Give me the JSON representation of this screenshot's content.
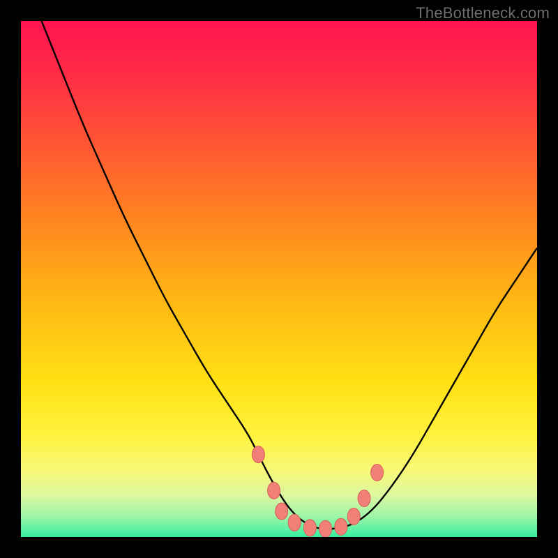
{
  "watermark": "TheBottleneck.com",
  "colors": {
    "gradient_stops": [
      {
        "offset": 0.0,
        "color": "#ff1450"
      },
      {
        "offset": 0.1,
        "color": "#ff2a46"
      },
      {
        "offset": 0.25,
        "color": "#ff5a32"
      },
      {
        "offset": 0.4,
        "color": "#ff8a1e"
      },
      {
        "offset": 0.55,
        "color": "#ffba14"
      },
      {
        "offset": 0.7,
        "color": "#ffe014"
      },
      {
        "offset": 0.8,
        "color": "#fff23c"
      },
      {
        "offset": 0.87,
        "color": "#f8f878"
      },
      {
        "offset": 0.92,
        "color": "#dcf8a0"
      },
      {
        "offset": 0.96,
        "color": "#9ef5a8"
      },
      {
        "offset": 1.0,
        "color": "#34f0a0"
      }
    ],
    "curve": "#000000",
    "marker_fill": "#f08078",
    "marker_stroke": "#d86058"
  },
  "chart_data": {
    "type": "line",
    "title": "",
    "xlabel": "",
    "ylabel": "",
    "xlim": [
      0,
      100
    ],
    "ylim": [
      0,
      100
    ],
    "grid": false,
    "curve": {
      "name": "bottleneck-curve",
      "x": [
        4,
        8,
        12,
        16,
        20,
        24,
        28,
        32,
        36,
        40,
        44,
        46,
        48,
        50,
        52,
        54,
        56,
        58,
        60,
        64,
        68,
        72,
        76,
        80,
        84,
        88,
        92,
        96,
        100
      ],
      "y": [
        100,
        90,
        80,
        71,
        62,
        54,
        46,
        39,
        32,
        26,
        20,
        16,
        12,
        8.5,
        5.5,
        3.5,
        2.2,
        1.6,
        1.5,
        2.2,
        5,
        10,
        16,
        23,
        30,
        37,
        44,
        50,
        56
      ]
    },
    "markers": [
      {
        "x": 46,
        "y": 16
      },
      {
        "x": 49,
        "y": 9
      },
      {
        "x": 50.5,
        "y": 5
      },
      {
        "x": 53,
        "y": 2.8
      },
      {
        "x": 56,
        "y": 1.8
      },
      {
        "x": 59,
        "y": 1.6
      },
      {
        "x": 62,
        "y": 2.0
      },
      {
        "x": 64.5,
        "y": 4.0
      },
      {
        "x": 66.5,
        "y": 7.5
      },
      {
        "x": 69,
        "y": 12.5
      }
    ]
  }
}
